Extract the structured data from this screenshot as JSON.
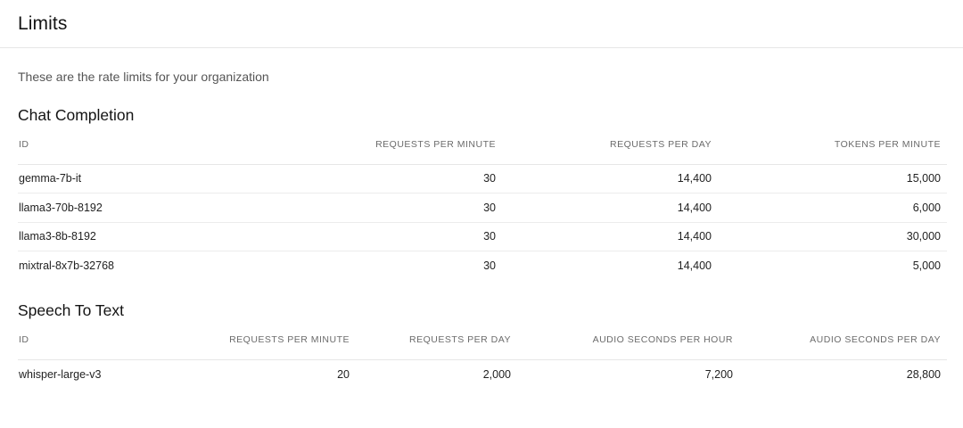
{
  "header": {
    "title": "Limits"
  },
  "intro": "These are the rate limits for your organization",
  "chat_completion": {
    "title": "Chat Completion",
    "columns": [
      "ID",
      "REQUESTS PER MINUTE",
      "REQUESTS PER DAY",
      "TOKENS PER MINUTE"
    ],
    "rows": [
      [
        "gemma-7b-it",
        "30",
        "14,400",
        "15,000"
      ],
      [
        "llama3-70b-8192",
        "30",
        "14,400",
        "6,000"
      ],
      [
        "llama3-8b-8192",
        "30",
        "14,400",
        "30,000"
      ],
      [
        "mixtral-8x7b-32768",
        "30",
        "14,400",
        "5,000"
      ]
    ]
  },
  "speech_to_text": {
    "title": "Speech To Text",
    "columns": [
      "ID",
      "REQUESTS PER MINUTE",
      "REQUESTS PER DAY",
      "AUDIO SECONDS PER HOUR",
      "AUDIO SECONDS PER DAY"
    ],
    "rows": [
      [
        "whisper-large-v3",
        "20",
        "2,000",
        "7,200",
        "28,800"
      ]
    ]
  }
}
